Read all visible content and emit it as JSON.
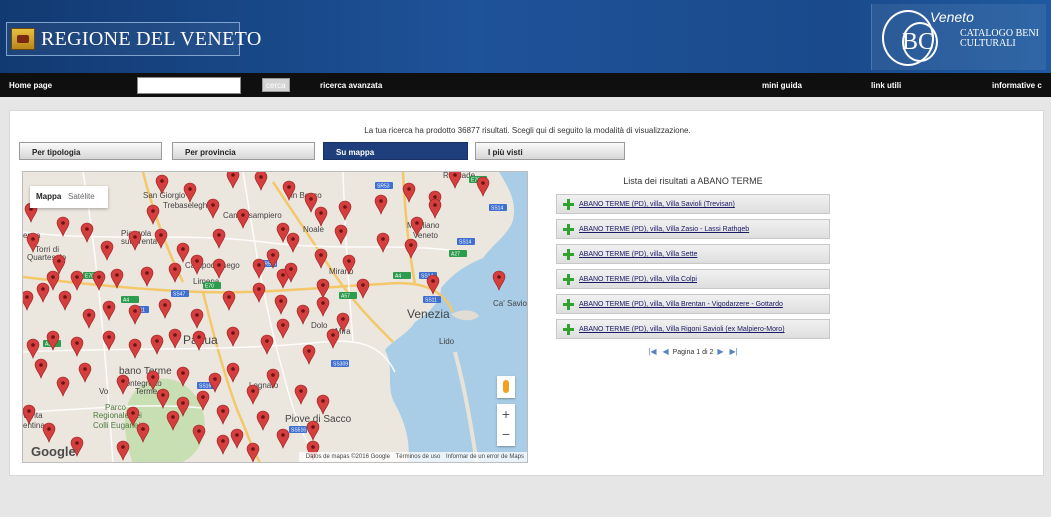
{
  "header": {
    "site_title": "REGIONE DEL VENETO",
    "catalog_veneto": "Veneto",
    "catalog_bc": "BC",
    "catalog_title": "Catalogo Beni Culturali"
  },
  "nav": {
    "home": "Home page",
    "search_value": "",
    "search_button": "cerca",
    "advanced": "ricerca avanzata",
    "guide": "mini guida",
    "links": "link utili",
    "info": "informative c"
  },
  "main": {
    "result_message": "La tua ricerca ha prodotto 36877 risultati. Scegli qui di seguito la modalità di visualizzazione.",
    "tabs": [
      {
        "label": "Per tipologia",
        "active": false
      },
      {
        "label": "Per provincia",
        "active": false
      },
      {
        "label": "Su mappa",
        "active": true
      },
      {
        "label": "I più visti",
        "active": false
      }
    ]
  },
  "map": {
    "type_map": "Mappa",
    "type_satellite": "Satélite",
    "google": "Google",
    "footer_data": "Datos de mapas ©2016 Google",
    "footer_terms": "Términos de uso",
    "footer_report": "Informar de un error de Maps",
    "zoom_in": "+",
    "zoom_out": "−",
    "place_labels": [
      "Roncade",
      "San Giorgio",
      "in Bosco",
      "Trebaseleghe",
      "Camposampiero",
      "Noale",
      "Mogliano",
      "Veneto",
      "enza",
      "Torri di",
      "Quartesolo",
      "Piazzola",
      "sul Brenta",
      "Campodarsego",
      "Mirano",
      "Limena",
      "Ca' Savio",
      "Venezia",
      "Padua",
      "Dolo",
      "Mira",
      "Lido",
      "bano Terme",
      "Montegrotto",
      "Terme",
      "Vo",
      "Parco",
      "Regionale dei",
      "Colli Euganei",
      "Piove di Sacco",
      "venta",
      "entina",
      "Legnaro"
    ],
    "road_labels": [
      "SR53",
      "E70",
      "SS14",
      "SS14",
      "A27",
      "SR515",
      "A4",
      "E70",
      "SS14",
      "A57",
      "A4",
      "SS47",
      "SS11",
      "SS11",
      "A31",
      "SS309",
      "SS516",
      "E70",
      "SS16"
    ]
  },
  "results": {
    "title": "Lista dei risultati a ABANO TERME",
    "items": [
      "ABANO TERME (PD), villa, Villa Savioli (Trevisan)",
      "ABANO TERME (PD), villa, Villa Zasio - Lassi Rathgeb",
      "ABANO TERME (PD), villa, Villa Sette",
      "ABANO TERME (PD), villa, Villa Colpi",
      "ABANO TERME (PD), villa, Villa Brentan - Vigodarzere - Gottardo",
      "ABANO TERME (PD), villa, Villa Rigoni Savioli (ex Malpiero-Moro)"
    ],
    "pager_first": "|◀",
    "pager_prev": "◀",
    "pager_text": "Pagina 1 di 2",
    "pager_next": "▶",
    "pager_last": "▶|"
  },
  "colors": {
    "header_bg": "#1a4a8c",
    "navbar_bg": "#0f0f0f",
    "active_tab": "#1f3f7c",
    "marker": "#d53e3e",
    "sea": "#a9cde6",
    "plus_icon": "#2fa22f"
  }
}
